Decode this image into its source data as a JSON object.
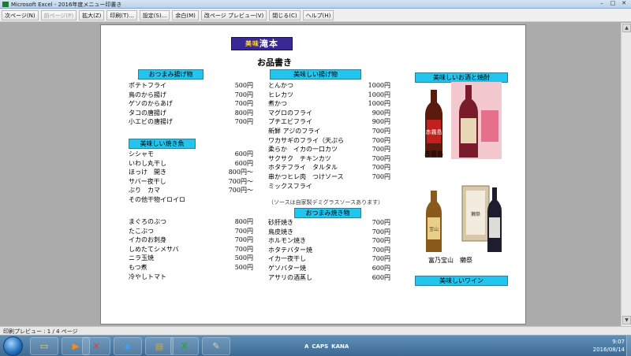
{
  "window": {
    "title": "Microsoft Excel - 2016年度メニュー印書き"
  },
  "toolbar": {
    "buttons": [
      {
        "label": "次ページ(N)",
        "disabled": false
      },
      {
        "label": "前ページ(P)",
        "disabled": true
      },
      {
        "label": "拡大(Z)",
        "disabled": false
      },
      {
        "label": "印刷(T)...",
        "disabled": false
      },
      {
        "label": "設定(S)...",
        "disabled": false
      },
      {
        "label": "余白(M)",
        "disabled": false
      },
      {
        "label": "改ページ プレビュー(V)",
        "disabled": false
      },
      {
        "label": "閉じる(C)",
        "disabled": false
      },
      {
        "label": "ヘルプ(H)",
        "disabled": false
      }
    ]
  },
  "status": {
    "text": "印刷プレビュー : 1 / 4 ページ"
  },
  "sheet": {
    "logo_hi": "美味",
    "logo_main": "滝本",
    "title": "お品書き",
    "col1": {
      "sec1": {
        "header": "おつまみ揚げ物",
        "items": [
          {
            "name": "ポテトフライ",
            "price": "500円"
          },
          {
            "name": "鳥のから揚げ",
            "price": "700円"
          },
          {
            "name": "ゲソのからあげ",
            "price": "700円"
          },
          {
            "name": "タコの唐揚げ",
            "price": "800円"
          },
          {
            "name": "小エビの唐揚げ",
            "price": "700円"
          }
        ]
      },
      "sec2": {
        "header": "美味しい焼き魚",
        "items": [
          {
            "name": "シシャモ",
            "price": "600円"
          },
          {
            "name": "いわし丸干し",
            "price": "600円"
          },
          {
            "name": "ほっけ　開き",
            "price": "800円～"
          },
          {
            "name": "サバー夜干し",
            "price": "700円～"
          },
          {
            "name": "ぶり　カマ",
            "price": "700円～"
          },
          {
            "name": "その他干物イロイロ",
            "price": ""
          }
        ]
      },
      "sec3": {
        "items": [
          {
            "name": "まぐろのぶつ",
            "price": "800円"
          },
          {
            "name": "たこぶつ",
            "price": "700円"
          },
          {
            "name": "イカのお刺身",
            "price": "700円"
          },
          {
            "name": "しめたてシメサバ",
            "price": "700円"
          },
          {
            "name": "ニラ玉焼",
            "price": "500円"
          },
          {
            "name": "もつ煮",
            "price": "500円"
          },
          {
            "name": "冷やしトマト",
            "price": ""
          }
        ]
      }
    },
    "col2": {
      "sec1": {
        "header": "美味しい揚げ物",
        "items": [
          {
            "name": "とんかつ",
            "price": "1000円"
          },
          {
            "name": "ヒレカツ",
            "price": "1000円"
          },
          {
            "name": "煮かつ",
            "price": "1000円"
          },
          {
            "name": "マグロのフライ",
            "price": "900円"
          },
          {
            "name": "プチエビフライ",
            "price": "900円"
          },
          {
            "name": "新鮮 アジのフライ",
            "price": "700円"
          },
          {
            "name": "ワカサギのフライ（天ぷら",
            "price": "700円"
          },
          {
            "name": "柔らか　イカの一口カツ",
            "price": "700円"
          },
          {
            "name": "サクサク　チキンカツ",
            "price": "700円"
          },
          {
            "name": "ホタテフライ　タルタル",
            "price": "700円"
          },
          {
            "name": "串かつヒレ肉　つけソース",
            "price": "700円"
          },
          {
            "name": "ミックスフライ",
            "price": ""
          }
        ],
        "note": "（ソースは自家製デミグラスソースあります）"
      },
      "sec2": {
        "header": "おつまみ焼き物",
        "items": [
          {
            "name": "砂肝焼き",
            "price": "700円"
          },
          {
            "name": "鳥皮焼き",
            "price": "700円"
          },
          {
            "name": "ホルモン焼き",
            "price": "700円"
          },
          {
            "name": "ホタテバター焼",
            "price": "700円"
          },
          {
            "name": "イカ一夜干し",
            "price": "700円"
          },
          {
            "name": "ゲソバター焼",
            "price": "600円"
          },
          {
            "name": "アサリの酒蒸し",
            "price": "600円"
          }
        ]
      }
    },
    "col3": {
      "header": "美味しいお酒と焼酎",
      "bottle_group1_label": "赤霧島",
      "bottle_group2_label": "富乃宝山　獺祭",
      "bottle_labels": [
        "赤霧島",
        "宝山",
        "獺祭"
      ],
      "wine_header": "美味しいワイン"
    }
  },
  "taskbar": {
    "tray": [
      "A",
      "CAPS",
      "KANA"
    ],
    "time": "9:07",
    "date": "2016/08/14"
  }
}
